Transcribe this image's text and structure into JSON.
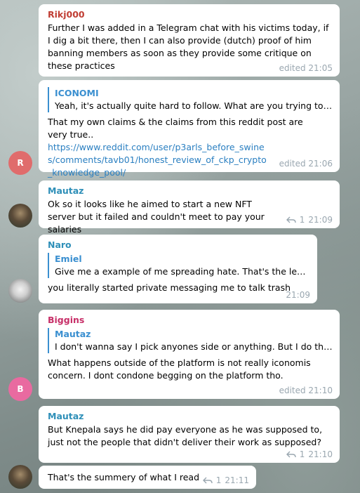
{
  "colors": {
    "rikj_name": "#c03d33",
    "mautaz_name": "#2e8fb8",
    "naro_name": "#2e8fb8",
    "biggins_name": "#c72e67",
    "reply_accent": "#3a8fd0",
    "avatar_r": "#e06c6c",
    "avatar_b": "#e96aa0"
  },
  "messages": [
    {
      "sender": "Rikj000",
      "text": "Further I was added in a Telegram chat with his victims today, if I dig a bit there, then I can also provide (dutch) proof of him banning members as soon as they provide some critique on these practices",
      "time": "edited 21:05"
    },
    {
      "reply_to": "ICONOMI",
      "reply_text": "Yeah, it's actually quite hard to follow. What are you trying to pr...",
      "text": "That my own claims & the claims from this reddit post are very true..",
      "link": "https://www.reddit.com/user/p3arls_before_swines/comments/tavb01/honest_review_of_ckp_crypto_knowledge_pool/",
      "time": "edited 21:06",
      "avatar_letter": "R"
    },
    {
      "sender": "Mautaz",
      "text": "Ok so it looks like he aimed to start a new NFT server but it failed and couldn't meet to pay your salaries",
      "replies": "1",
      "time": "21:09"
    },
    {
      "sender": "Naro",
      "reply_to": "Emiel",
      "reply_text": "Give me a example of me spreading hate. That's the least ...",
      "text": "you literally started private messaging me to talk trash",
      "time": "21:09"
    },
    {
      "sender": "Biggins",
      "reply_to": "Mautaz",
      "reply_text": "I don't wanna say I pick anyones side or anything. But I do think...",
      "text": "What happens outside of the platform is not really iconomis concern. I dont condone begging on the platform tho.",
      "time": "edited 21:10",
      "avatar_letter": "B"
    },
    {
      "sender": "Mautaz",
      "text": "But Knepala says he did pay everyone as he was supposed to, just not the people that didn't deliver their work as supposed?",
      "replies": "1",
      "time": "21:10"
    },
    {
      "text": "That's the summery of what I read",
      "replies": "1",
      "time": "21:11"
    }
  ]
}
